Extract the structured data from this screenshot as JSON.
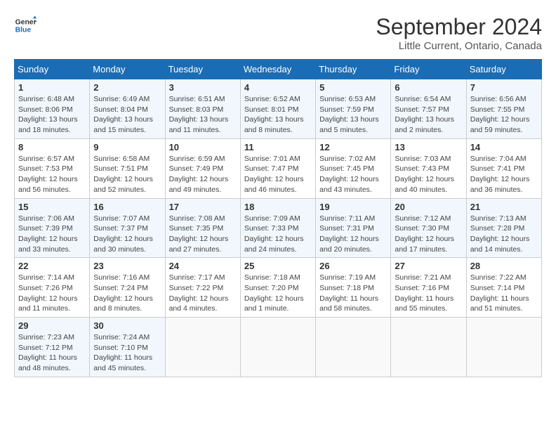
{
  "logo": {
    "line1": "General",
    "line2": "Blue"
  },
  "title": "September 2024",
  "subtitle": "Little Current, Ontario, Canada",
  "days_of_week": [
    "Sunday",
    "Monday",
    "Tuesday",
    "Wednesday",
    "Thursday",
    "Friday",
    "Saturday"
  ],
  "weeks": [
    [
      {
        "day": "1",
        "detail": "Sunrise: 6:48 AM\nSunset: 8:06 PM\nDaylight: 13 hours\nand 18 minutes."
      },
      {
        "day": "2",
        "detail": "Sunrise: 6:49 AM\nSunset: 8:04 PM\nDaylight: 13 hours\nand 15 minutes."
      },
      {
        "day": "3",
        "detail": "Sunrise: 6:51 AM\nSunset: 8:03 PM\nDaylight: 13 hours\nand 11 minutes."
      },
      {
        "day": "4",
        "detail": "Sunrise: 6:52 AM\nSunset: 8:01 PM\nDaylight: 13 hours\nand 8 minutes."
      },
      {
        "day": "5",
        "detail": "Sunrise: 6:53 AM\nSunset: 7:59 PM\nDaylight: 13 hours\nand 5 minutes."
      },
      {
        "day": "6",
        "detail": "Sunrise: 6:54 AM\nSunset: 7:57 PM\nDaylight: 13 hours\nand 2 minutes."
      },
      {
        "day": "7",
        "detail": "Sunrise: 6:56 AM\nSunset: 7:55 PM\nDaylight: 12 hours\nand 59 minutes."
      }
    ],
    [
      {
        "day": "8",
        "detail": "Sunrise: 6:57 AM\nSunset: 7:53 PM\nDaylight: 12 hours\nand 56 minutes."
      },
      {
        "day": "9",
        "detail": "Sunrise: 6:58 AM\nSunset: 7:51 PM\nDaylight: 12 hours\nand 52 minutes."
      },
      {
        "day": "10",
        "detail": "Sunrise: 6:59 AM\nSunset: 7:49 PM\nDaylight: 12 hours\nand 49 minutes."
      },
      {
        "day": "11",
        "detail": "Sunrise: 7:01 AM\nSunset: 7:47 PM\nDaylight: 12 hours\nand 46 minutes."
      },
      {
        "day": "12",
        "detail": "Sunrise: 7:02 AM\nSunset: 7:45 PM\nDaylight: 12 hours\nand 43 minutes."
      },
      {
        "day": "13",
        "detail": "Sunrise: 7:03 AM\nSunset: 7:43 PM\nDaylight: 12 hours\nand 40 minutes."
      },
      {
        "day": "14",
        "detail": "Sunrise: 7:04 AM\nSunset: 7:41 PM\nDaylight: 12 hours\nand 36 minutes."
      }
    ],
    [
      {
        "day": "15",
        "detail": "Sunrise: 7:06 AM\nSunset: 7:39 PM\nDaylight: 12 hours\nand 33 minutes."
      },
      {
        "day": "16",
        "detail": "Sunrise: 7:07 AM\nSunset: 7:37 PM\nDaylight: 12 hours\nand 30 minutes."
      },
      {
        "day": "17",
        "detail": "Sunrise: 7:08 AM\nSunset: 7:35 PM\nDaylight: 12 hours\nand 27 minutes."
      },
      {
        "day": "18",
        "detail": "Sunrise: 7:09 AM\nSunset: 7:33 PM\nDaylight: 12 hours\nand 24 minutes."
      },
      {
        "day": "19",
        "detail": "Sunrise: 7:11 AM\nSunset: 7:31 PM\nDaylight: 12 hours\nand 20 minutes."
      },
      {
        "day": "20",
        "detail": "Sunrise: 7:12 AM\nSunset: 7:30 PM\nDaylight: 12 hours\nand 17 minutes."
      },
      {
        "day": "21",
        "detail": "Sunrise: 7:13 AM\nSunset: 7:28 PM\nDaylight: 12 hours\nand 14 minutes."
      }
    ],
    [
      {
        "day": "22",
        "detail": "Sunrise: 7:14 AM\nSunset: 7:26 PM\nDaylight: 12 hours\nand 11 minutes."
      },
      {
        "day": "23",
        "detail": "Sunrise: 7:16 AM\nSunset: 7:24 PM\nDaylight: 12 hours\nand 8 minutes."
      },
      {
        "day": "24",
        "detail": "Sunrise: 7:17 AM\nSunset: 7:22 PM\nDaylight: 12 hours\nand 4 minutes."
      },
      {
        "day": "25",
        "detail": "Sunrise: 7:18 AM\nSunset: 7:20 PM\nDaylight: 12 hours\nand 1 minute."
      },
      {
        "day": "26",
        "detail": "Sunrise: 7:19 AM\nSunset: 7:18 PM\nDaylight: 11 hours\nand 58 minutes."
      },
      {
        "day": "27",
        "detail": "Sunrise: 7:21 AM\nSunset: 7:16 PM\nDaylight: 11 hours\nand 55 minutes."
      },
      {
        "day": "28",
        "detail": "Sunrise: 7:22 AM\nSunset: 7:14 PM\nDaylight: 11 hours\nand 51 minutes."
      }
    ],
    [
      {
        "day": "29",
        "detail": "Sunrise: 7:23 AM\nSunset: 7:12 PM\nDaylight: 11 hours\nand 48 minutes."
      },
      {
        "day": "30",
        "detail": "Sunrise: 7:24 AM\nSunset: 7:10 PM\nDaylight: 11 hours\nand 45 minutes."
      },
      {
        "day": "",
        "detail": ""
      },
      {
        "day": "",
        "detail": ""
      },
      {
        "day": "",
        "detail": ""
      },
      {
        "day": "",
        "detail": ""
      },
      {
        "day": "",
        "detail": ""
      }
    ]
  ]
}
